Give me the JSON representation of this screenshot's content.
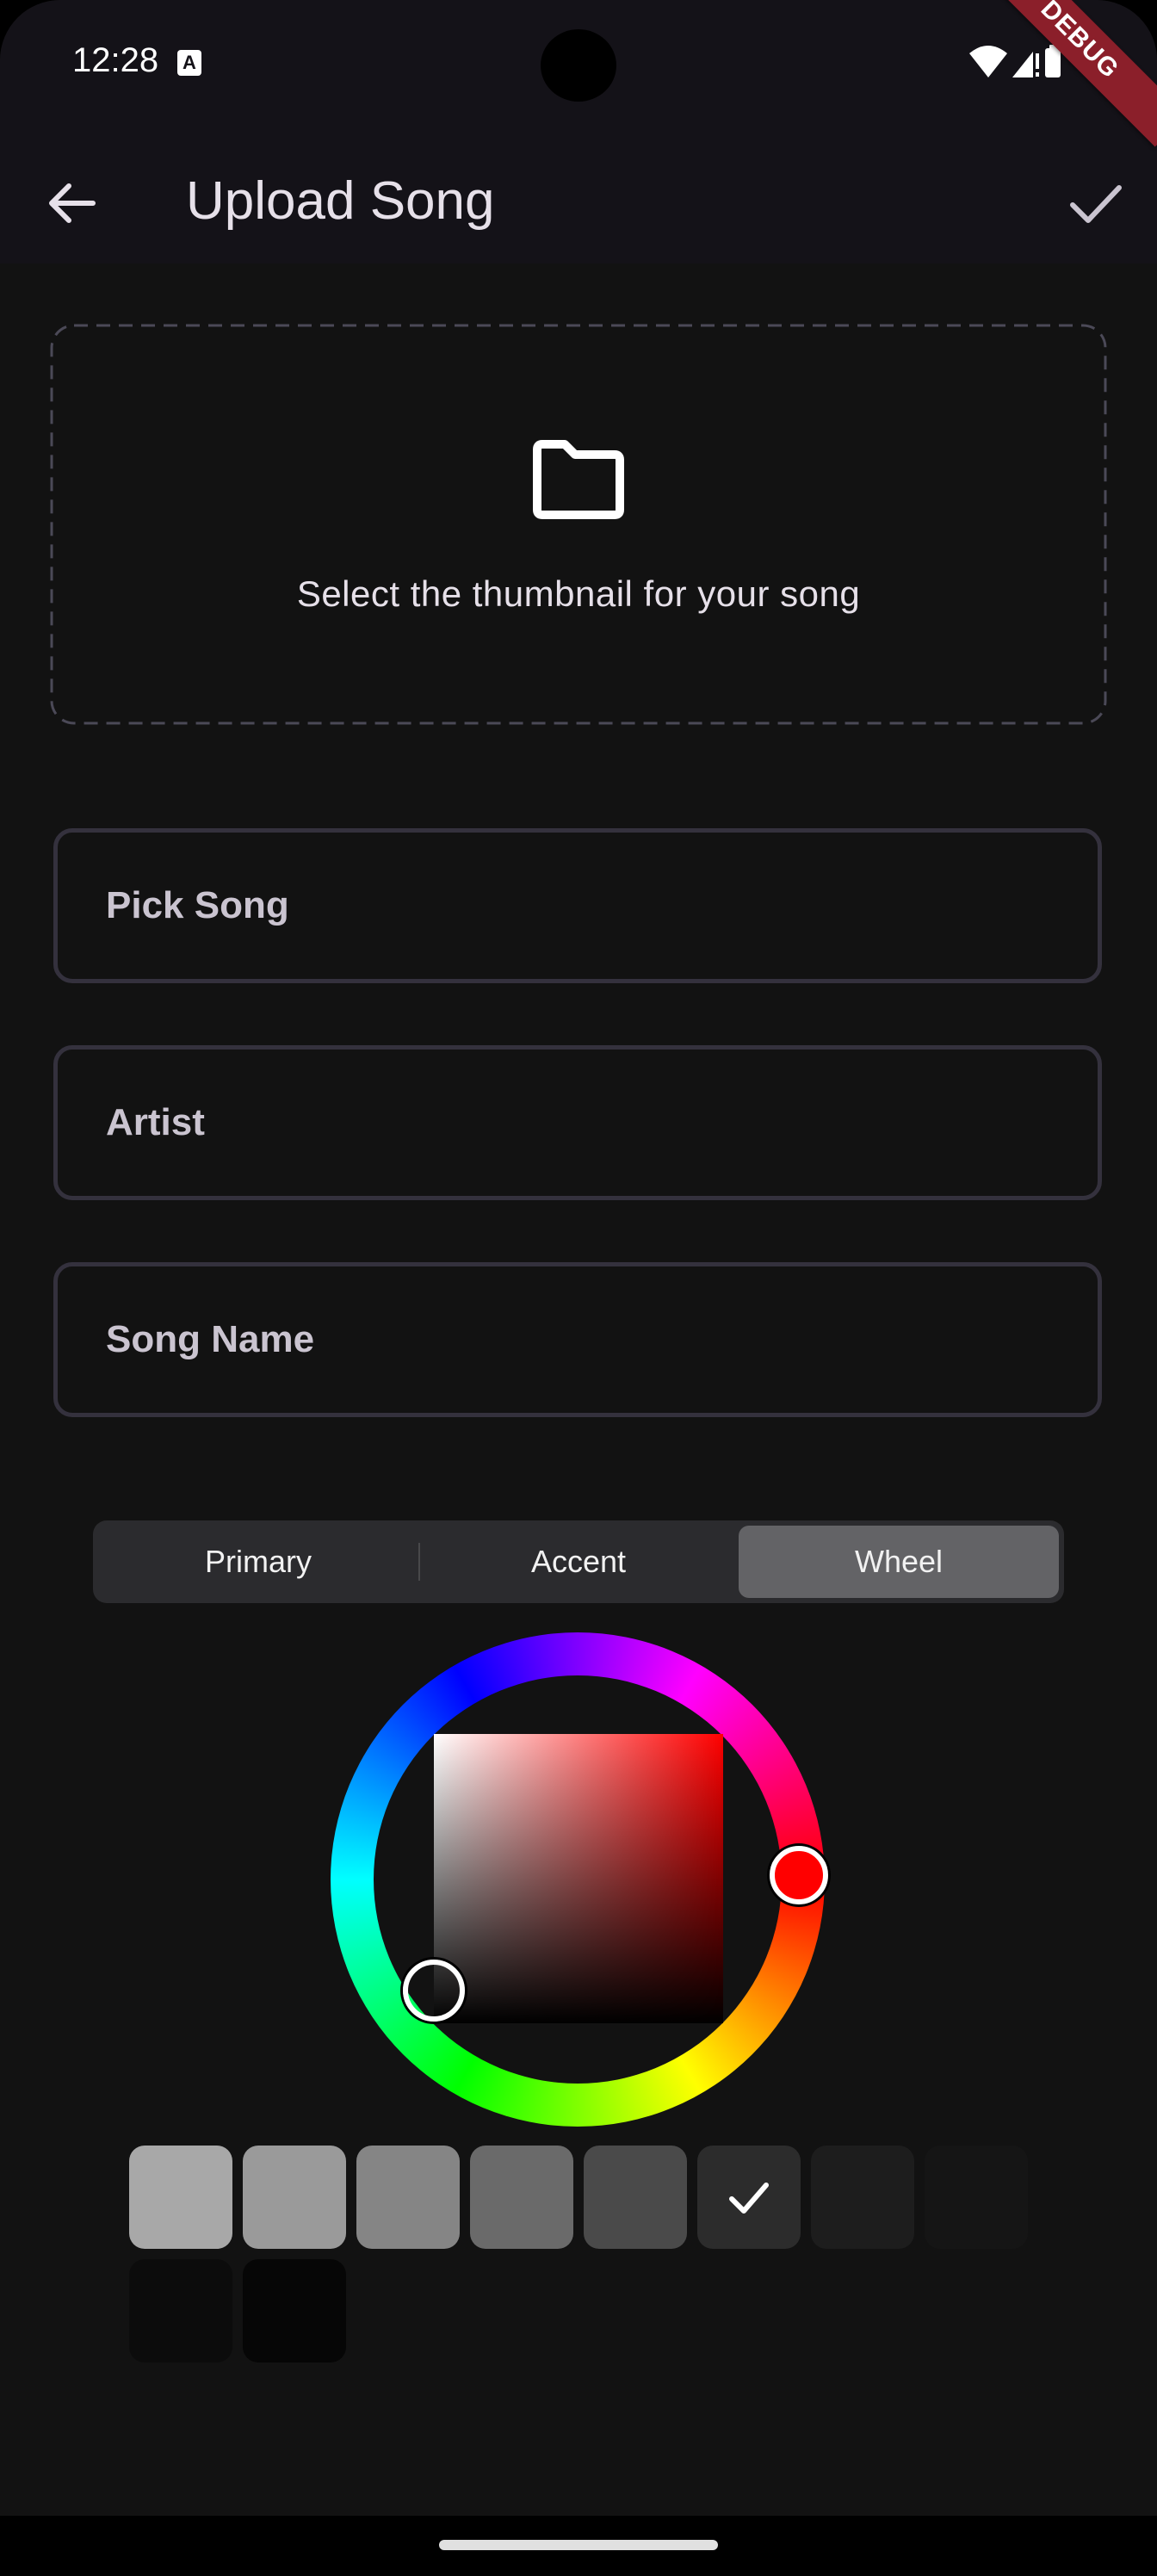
{
  "status_bar": {
    "time": "12:28",
    "notification_badge": "A"
  },
  "debug_banner": "DEBUG",
  "app_bar": {
    "title": "Upload Song",
    "back_icon": "arrow-left-icon",
    "confirm_icon": "check-icon"
  },
  "thumbnail_picker": {
    "icon": "folder-icon",
    "label": "Select the thumbnail for your song"
  },
  "fields": {
    "pick_song": {
      "placeholder": "Pick Song",
      "value": ""
    },
    "artist": {
      "placeholder": "Artist",
      "value": ""
    },
    "song_name": {
      "placeholder": "Song Name",
      "value": ""
    }
  },
  "color_picker": {
    "tabs": [
      "Primary",
      "Accent",
      "Wheel"
    ],
    "selected_tab": "Wheel",
    "selected_color": "#ff0000",
    "swatches": [
      {
        "color": "#a8a8a8",
        "selected": false
      },
      {
        "color": "#9a9a9a",
        "selected": false
      },
      {
        "color": "#858585",
        "selected": false
      },
      {
        "color": "#6a6a6a",
        "selected": false
      },
      {
        "color": "#4a4a4a",
        "selected": false
      },
      {
        "color": "#2c2c2c",
        "selected": true
      },
      {
        "color": "#1d1d1d",
        "selected": false
      },
      {
        "color": "#151515",
        "selected": false
      },
      {
        "color": "#0c0c0c",
        "selected": false
      },
      {
        "color": "#060606",
        "selected": false
      }
    ]
  },
  "colors": {
    "background": "#121212",
    "app_bar": "#141218",
    "field_border": "#34313d",
    "text": "#e6e0e9"
  }
}
